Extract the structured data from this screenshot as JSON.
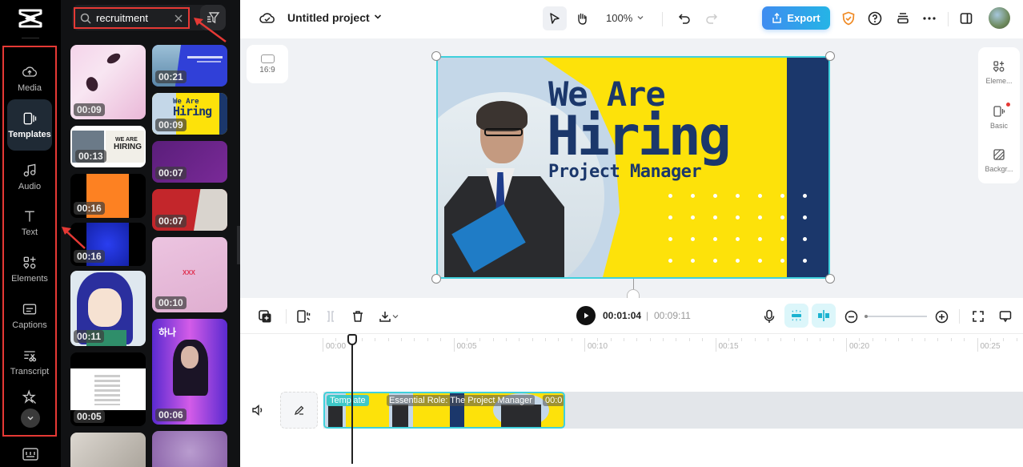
{
  "rail": {
    "items": [
      {
        "label": "Media",
        "icon": "cloud-upload-icon"
      },
      {
        "label": "Templates",
        "icon": "templates-icon",
        "active": true
      },
      {
        "label": "Audio",
        "icon": "music-note-icon"
      },
      {
        "label": "Text",
        "icon": "text-icon"
      },
      {
        "label": "Elements",
        "icon": "elements-icon"
      },
      {
        "label": "Captions",
        "icon": "captions-icon"
      },
      {
        "label": "Transcript",
        "icon": "transcript-icon"
      },
      {
        "label": "Effects",
        "icon": "effects-star-icon"
      }
    ]
  },
  "panel": {
    "search_value": "recruitment",
    "thumbnails": [
      {
        "duration": "00:09",
        "desc": "Pink anime face"
      },
      {
        "duration": "00:21",
        "desc": "Marketing Agency - Join our team"
      },
      {
        "duration": "00:09",
        "desc": "We Are Hiring - Project Manager"
      },
      {
        "duration": "00:13",
        "desc": "We Are Hiring - join our team"
      },
      {
        "duration": "00:07",
        "desc": "Graphic Designer purple"
      },
      {
        "duration": "00:16",
        "desc": "Orange square"
      },
      {
        "duration": "00:07",
        "desc": "Open recruitment red"
      },
      {
        "duration": "00:16",
        "desc": "Blue square"
      },
      {
        "duration": "00:10",
        "desc": "Pink textured"
      },
      {
        "duration": "00:11",
        "desc": "Anime girl blue hair"
      },
      {
        "duration": "00:06",
        "desc": "Korean poster 하나"
      },
      {
        "duration": "00:05",
        "desc": "White text card"
      },
      {
        "duration": "",
        "desc": "Anime cat girl"
      },
      {
        "duration": "",
        "desc": "Purple abstract"
      }
    ]
  },
  "topbar": {
    "project_title": "Untitled project",
    "zoom": "100%",
    "export_label": "Export"
  },
  "canvas": {
    "aspect_ratio": "16:9",
    "headline_1": "We Are",
    "headline_2": "Hiring",
    "headline_3": "Project Manager",
    "colors": {
      "yellow": "#fde20a",
      "navy": "#1b376b",
      "light_blue": "#c4d7e8",
      "selection": "#3fd0dc"
    }
  },
  "right_tools": [
    {
      "label": "Eleme...",
      "icon": "elements-icon"
    },
    {
      "label": "Basic",
      "icon": "basic-icon",
      "badge": true
    },
    {
      "label": "Backgr...",
      "icon": "background-icon"
    }
  ],
  "timeline": {
    "current_time": "00:01:04",
    "separator": "|",
    "total_time": "00:09:11",
    "ruler_labels": [
      "00:00",
      "00:05",
      "00:10",
      "00:15",
      "00:20",
      "00:25"
    ],
    "clip": {
      "tag": "Template",
      "name": "Essential Role: The Project Manager",
      "duration": "00:0"
    }
  }
}
